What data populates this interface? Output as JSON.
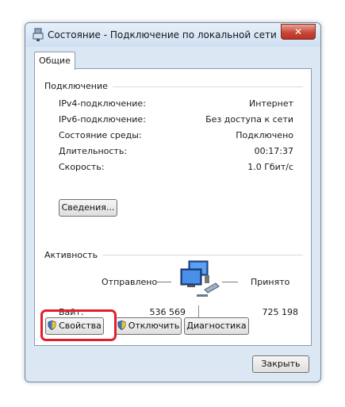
{
  "window": {
    "title": "Состояние - Подключение по локальной сети",
    "close_label": "✕"
  },
  "tabs": [
    {
      "label": "Общие"
    }
  ],
  "connection": {
    "group_label": "Подключение",
    "rows": [
      {
        "label": "IPv4-подключение:",
        "value": "Интернет"
      },
      {
        "label": "IPv6-подключение:",
        "value": "Без доступа к сети"
      },
      {
        "label": "Состояние среды:",
        "value": "Подключено"
      },
      {
        "label": "Длительность:",
        "value": "00:17:37"
      },
      {
        "label": "Скорость:",
        "value": "1.0 Гбит/с"
      }
    ],
    "details_button": "Сведения..."
  },
  "activity": {
    "group_label": "Активность",
    "sent_label": "Отправлено",
    "received_label": "Принято",
    "bytes_label": "Байт:",
    "bytes_sent": "536 569",
    "bytes_received": "725 198"
  },
  "actions": {
    "properties": "Свойства",
    "disable": "Отключить",
    "diagnose": "Диагностика"
  },
  "footer": {
    "close_button": "Закрыть"
  },
  "icons": [
    "network-adapter-icon",
    "shield-icon",
    "network-computers-icon",
    "close-icon"
  ],
  "colors": {
    "highlight": "#e0202a",
    "window_frame": "#dbe7f3"
  }
}
